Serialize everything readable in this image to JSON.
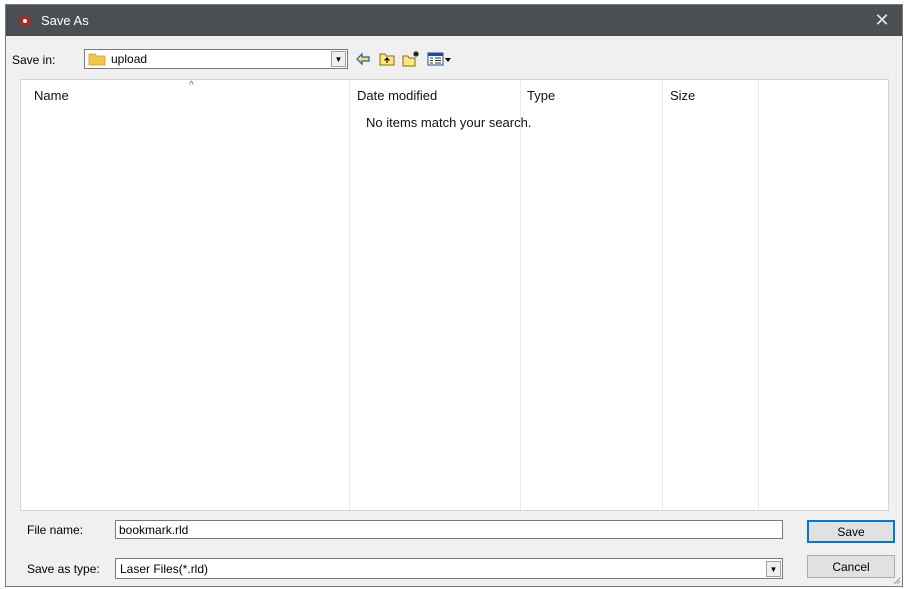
{
  "window": {
    "title": "Save As",
    "close_glyph": "✕",
    "icon": "app-star-icon"
  },
  "toolbar": {
    "save_in_label": "Save in:",
    "save_in_value": "upload",
    "icons": [
      "folder-icon",
      "back-arrow-icon",
      "up-folder-icon",
      "new-folder-icon",
      "view-menu-icon"
    ]
  },
  "file_list": {
    "columns": [
      "Name",
      "Date modified",
      "Type",
      "Size"
    ],
    "sorted_column": "Name",
    "sort_glyph": "^",
    "empty_message": "No items match your search."
  },
  "form": {
    "file_name_label": "File name:",
    "file_name_value": "bookmark.rld",
    "save_as_type_label": "Save as type:",
    "save_as_type_value": "Laser Files(*.rld)"
  },
  "buttons": {
    "save": "Save",
    "cancel": "Cancel"
  },
  "colors": {
    "titlebar": "#4a4f54",
    "icon_red": "#cc1a1a",
    "folder_yellow": "#f2c54b",
    "accent": "#0078d7"
  }
}
